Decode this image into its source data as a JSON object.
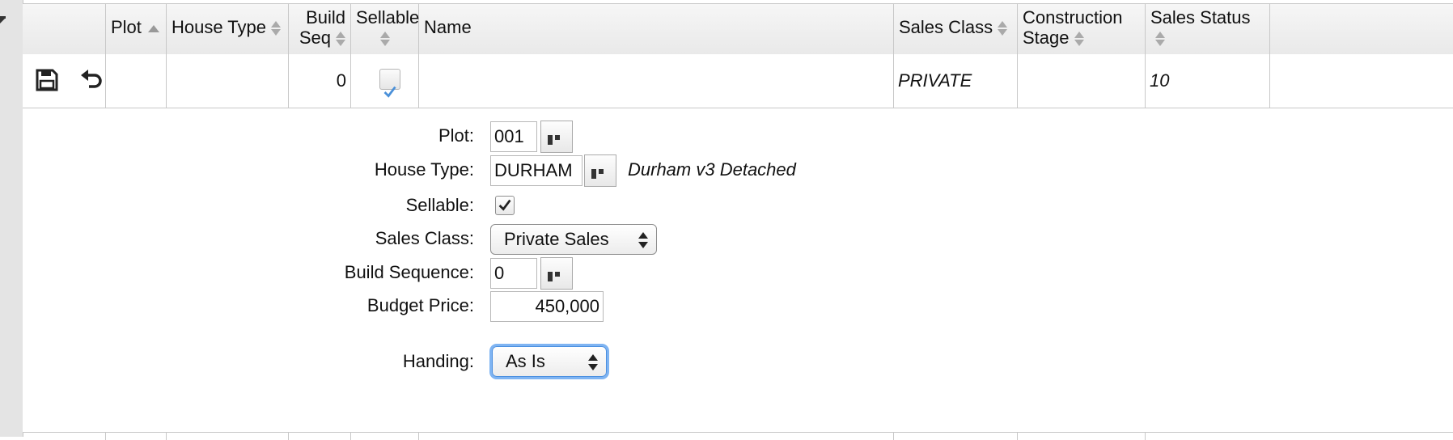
{
  "grid": {
    "columns": [
      {
        "key": "actions",
        "label": "",
        "sort": "none"
      },
      {
        "key": "plot",
        "label": "Plot",
        "sort": "asc"
      },
      {
        "key": "house_type",
        "label": "House Type",
        "sort": "both"
      },
      {
        "key": "build_seq",
        "label_l1": "Build",
        "label_l2": "Seq",
        "sort": "both"
      },
      {
        "key": "sellable",
        "label": "Sellable",
        "sort": "both"
      },
      {
        "key": "name",
        "label": "Name",
        "sort": "none"
      },
      {
        "key": "sales_class",
        "label": "Sales Class",
        "sort": "both"
      },
      {
        "key": "construction_stage",
        "label_l1": "Construction",
        "label_l2": "Stage",
        "sort": "both"
      },
      {
        "key": "sales_status",
        "label": "Sales Status",
        "sort": "both"
      }
    ],
    "row": {
      "plot": "",
      "house_type": "",
      "build_seq": "0",
      "sellable": true,
      "name": "",
      "sales_class": "PRIVATE",
      "construction_stage": "",
      "sales_status": "10"
    }
  },
  "form": {
    "plot": {
      "label": "Plot:",
      "value": "001"
    },
    "house_type": {
      "label": "House Type:",
      "value": "DURHAM",
      "description": "Durham v3 Detached"
    },
    "sellable": {
      "label": "Sellable:",
      "checked": true
    },
    "sales_class": {
      "label": "Sales Class:",
      "value": "Private Sales"
    },
    "build_sequence": {
      "label": "Build Sequence:",
      "value": "0"
    },
    "budget_price": {
      "label": "Budget Price:",
      "value": "450,000"
    },
    "handing": {
      "label": "Handing:",
      "value": "As Is"
    }
  },
  "colors": {
    "focus": "#7fb4f2",
    "checkmark_blue": "#4a90d9",
    "grid_line": "#c8c8c8"
  }
}
